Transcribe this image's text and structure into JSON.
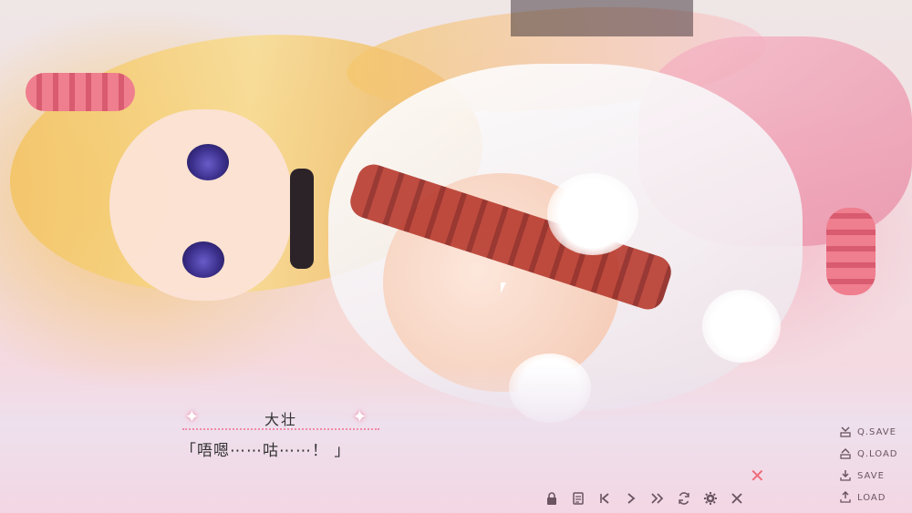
{
  "dialogue": {
    "speaker": "大壮",
    "text": "「唔嗯⋯⋯咕⋯⋯！ 」"
  },
  "side_menu": [
    {
      "label": "Q.SAVE",
      "icon": "quick-save-icon"
    },
    {
      "label": "Q.LOAD",
      "icon": "quick-load-icon"
    },
    {
      "label": "SAVE",
      "icon": "save-icon"
    },
    {
      "label": "LOAD",
      "icon": "load-icon"
    }
  ],
  "toolbar": [
    {
      "icon": "lock-icon"
    },
    {
      "icon": "log-icon"
    },
    {
      "icon": "skip-back-icon"
    },
    {
      "icon": "next-icon"
    },
    {
      "icon": "fast-forward-icon"
    },
    {
      "icon": "auto-icon"
    },
    {
      "icon": "settings-icon"
    },
    {
      "icon": "close-icon"
    }
  ],
  "colors": {
    "accent": "#f08aa8",
    "ui_icon": "#6a5560",
    "text": "#333333"
  }
}
